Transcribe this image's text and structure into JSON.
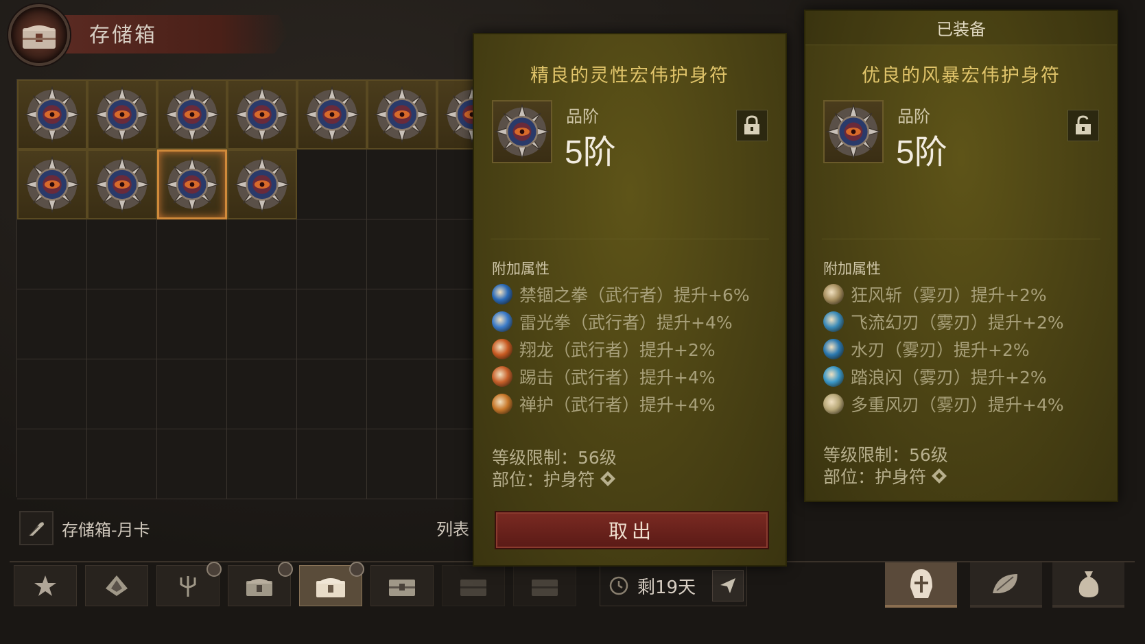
{
  "header": {
    "title": "存储箱"
  },
  "storage": {
    "filled_slots": 11,
    "label": "存储箱-月卡",
    "list_label": "列表"
  },
  "bottom": {
    "days_left": "剩19天"
  },
  "item_compare": {
    "item_name": "精良的灵性宏伟护身符",
    "grade_label": "品阶",
    "grade_value": "5阶",
    "section_title": "附加属性",
    "attributes": [
      {
        "text": "禁锢之拳（武行者）提升+6%",
        "icon": "blue-fist-icon",
        "color": "#2a6ab8"
      },
      {
        "text": "雷光拳（武行者）提升+4%",
        "icon": "lightning-fist-icon",
        "color": "#3a7ac8"
      },
      {
        "text": "翔龙（武行者）提升+2%",
        "icon": "dragon-icon",
        "color": "#c85a22"
      },
      {
        "text": "踢击（武行者）提升+4%",
        "icon": "kick-icon",
        "color": "#c8602a"
      },
      {
        "text": "禅护（武行者）提升+4%",
        "icon": "zen-guard-icon",
        "color": "#c8782a"
      }
    ],
    "level_req": "等级限制：56级",
    "slot": "部位：护身符",
    "take_out_label": "取出"
  },
  "item_equipped": {
    "equipped_label": "已装备",
    "item_name": "优良的风暴宏伟护身符",
    "grade_label": "品阶",
    "grade_value": "5阶",
    "section_title": "附加属性",
    "attributes": [
      {
        "text": "狂风斩（雾刃）提升+2%",
        "icon": "gale-slash-icon",
        "color": "#a89060"
      },
      {
        "text": "飞流幻刃（雾刃）提升+2%",
        "icon": "flow-blade-icon",
        "color": "#3a8ab8"
      },
      {
        "text": "水刃（雾刃）提升+2%",
        "icon": "water-blade-icon",
        "color": "#2a78b0"
      },
      {
        "text": "踏浪闪（雾刃）提升+2%",
        "icon": "wave-step-icon",
        "color": "#3a98c8"
      },
      {
        "text": "多重风刃（雾刃）提升+4%",
        "icon": "multi-wind-blade-icon",
        "color": "#b8a878"
      }
    ],
    "level_req": "等级限制：56级",
    "slot": "部位：护身符"
  },
  "colors": {
    "panel_bg": "#4a4214",
    "item_name": "#e0c46a",
    "button_red": "#7a2a22",
    "selected_border": "#d08a3a"
  }
}
